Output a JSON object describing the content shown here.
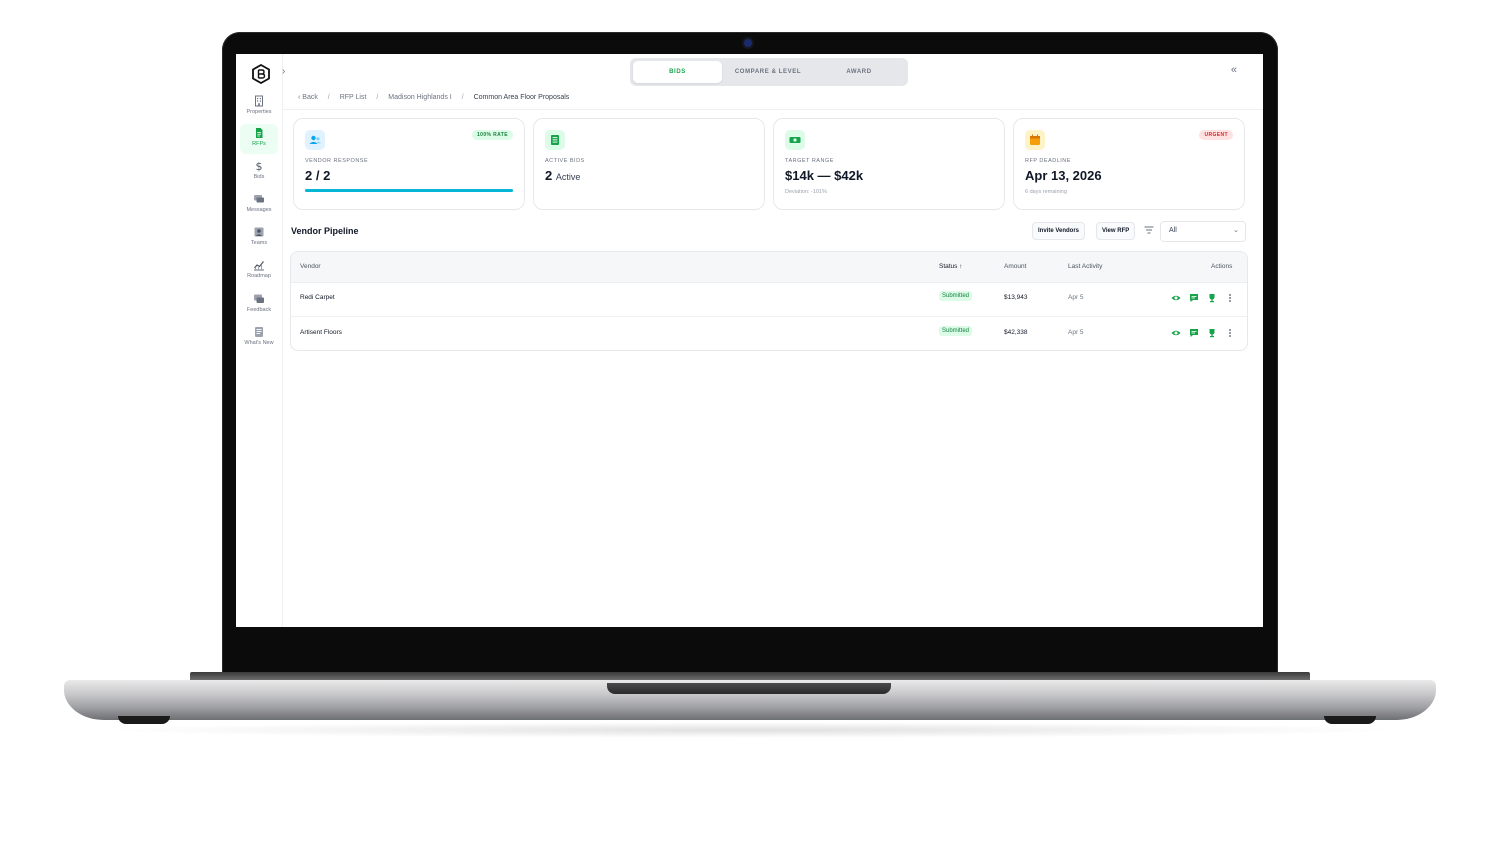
{
  "nav": {
    "items": [
      {
        "label": "Properties",
        "icon": "building-icon"
      },
      {
        "label": "RFPs",
        "icon": "document-icon",
        "active": true
      },
      {
        "label": "Bids",
        "icon": "dollar-icon"
      },
      {
        "label": "Messages",
        "icon": "chat-icon"
      },
      {
        "label": "Teams",
        "icon": "team-icon"
      },
      {
        "label": "Roadmap",
        "icon": "chart-icon"
      },
      {
        "label": "Feedback",
        "icon": "feedback-icon"
      },
      {
        "label": "What's New",
        "icon": "news-icon"
      }
    ]
  },
  "tabs": {
    "bids": "BIDS",
    "compare": "COMPARE & LEVEL",
    "award": "AWARD",
    "active": "BIDS"
  },
  "breadcrumb": {
    "back": "‹ Back",
    "rfp_list": "RFP List",
    "property": "Madison Highlands I",
    "current": "Common Area Floor Proposals"
  },
  "cards": {
    "vendor_response": {
      "label": "VENDOR RESPONSE",
      "value": "2 / 2",
      "badge": "100% RATE",
      "progress": 1.0
    },
    "active_bids": {
      "label": "ACTIVE BIDS",
      "value": "2",
      "suffix": "Active"
    },
    "target_range": {
      "label": "TARGET RANGE",
      "value": "$14k — $42k",
      "sub": "Deviation: -101%"
    },
    "rfp_deadline": {
      "label": "RFP DEADLINE",
      "value": "Apr 13, 2026",
      "sub": "6 days remaining",
      "badge": "URGENT"
    }
  },
  "pipeline": {
    "title": "Vendor Pipeline",
    "invite_label": "Invite Vendors",
    "view_rfp_label": "View RFP",
    "filter_value": "All",
    "columns": {
      "vendor": "Vendor",
      "status": "Status ↑",
      "amount": "Amount",
      "last_activity": "Last Activity",
      "actions": "Actions"
    },
    "rows": [
      {
        "vendor": "Redi Carpet",
        "status": "Submitted",
        "amount": "$13,943",
        "last_activity": "Apr 5"
      },
      {
        "vendor": "Artisent Floors",
        "status": "Submitted",
        "amount": "$42,338",
        "last_activity": "Apr 5"
      }
    ]
  },
  "colors": {
    "accent": "#16a34a",
    "progress": "#06b6d4",
    "urgent": "#dc2626"
  }
}
